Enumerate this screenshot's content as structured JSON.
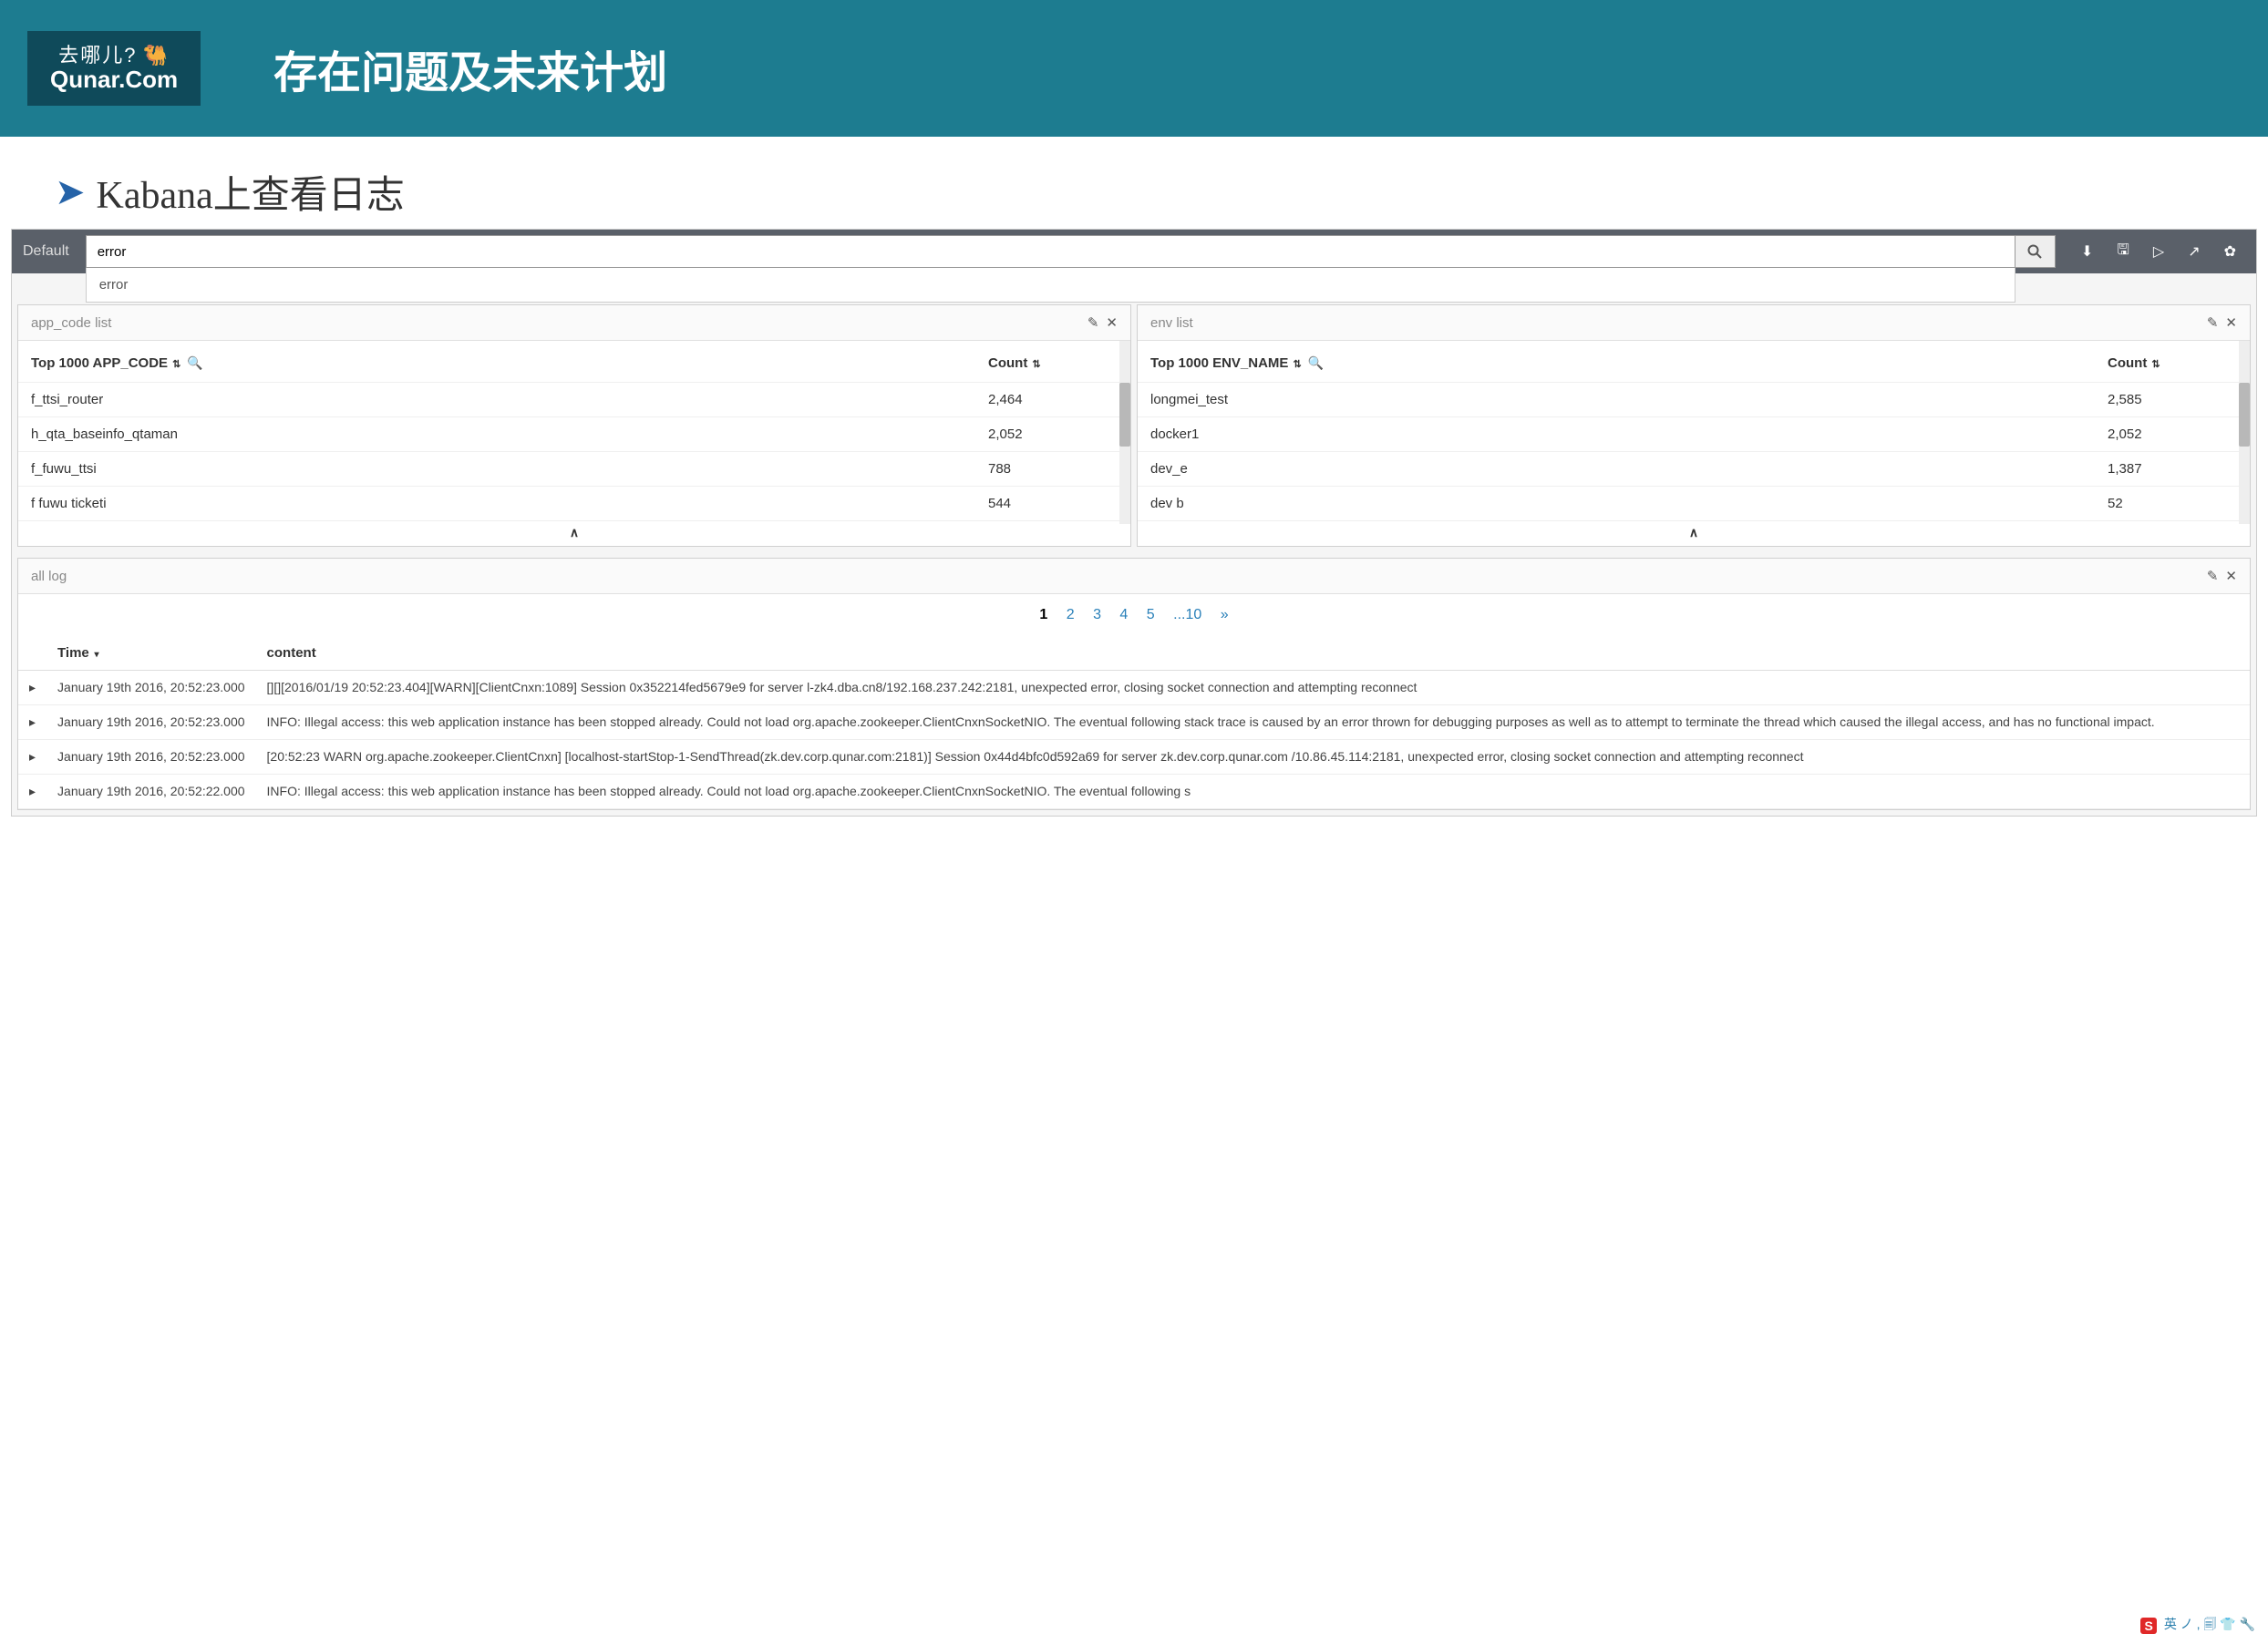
{
  "header": {
    "logo_top": "去哪儿?",
    "logo_bottom": "Qunar.Com",
    "title": "存在问题及未来计划"
  },
  "subtitle": "Kabana上查看日志",
  "search": {
    "default_label": "Default",
    "value": "error",
    "suggestion": "error"
  },
  "panels": {
    "app_code": {
      "title": "app_code list",
      "col1": "Top 1000 APP_CODE",
      "col2": "Count",
      "rows": [
        {
          "name": "f_ttsi_router",
          "count": "2,464"
        },
        {
          "name": "h_qta_baseinfo_qtaman",
          "count": "2,052"
        },
        {
          "name": "f_fuwu_ttsi",
          "count": "788"
        },
        {
          "name": "f fuwu ticketi",
          "count": "544"
        }
      ],
      "footer_arrow": "∧"
    },
    "env": {
      "title": "env list",
      "col1": "Top 1000 ENV_NAME",
      "col2": "Count",
      "rows": [
        {
          "name": "longmei_test",
          "count": "2,585"
        },
        {
          "name": "docker1",
          "count": "2,052"
        },
        {
          "name": "dev_e",
          "count": "1,387"
        },
        {
          "name": "dev b",
          "count": "52"
        }
      ],
      "footer_arrow": "∧"
    }
  },
  "logs": {
    "title": "all log",
    "pager": {
      "current": "1",
      "pages": [
        "2",
        "3",
        "4",
        "5",
        "...10"
      ],
      "next": "»"
    },
    "col_time": "Time",
    "col_content": "content",
    "rows": [
      {
        "time": "January 19th 2016, 20:52:23.000",
        "content": "[][][2016/01/19 20:52:23.404][WARN][ClientCnxn:1089] Session 0x352214fed5679e9 for server l-zk4.dba.cn8/192.168.237.242:2181, unexpected error, closing socket connection and attempting reconnect"
      },
      {
        "time": "January 19th 2016, 20:52:23.000",
        "content": "INFO: Illegal access: this web application instance has been stopped already.  Could not load org.apache.zookeeper.ClientCnxnSocketNIO.  The eventual following stack trace is caused by an error thrown for debugging purposes as well as to attempt to terminate the thread which caused the illegal access, and has no functional impact."
      },
      {
        "time": "January 19th 2016, 20:52:23.000",
        "content": "[20:52:23 WARN org.apache.zookeeper.ClientCnxn] [localhost-startStop-1-SendThread(zk.dev.corp.qunar.com:2181)] Session 0x44d4bfc0d592a69 for server zk.dev.corp.qunar.com /10.86.45.114:2181, unexpected error, closing socket connection and attempting reconnect"
      },
      {
        "time": "January 19th 2016, 20:52:22.000",
        "content": "INFO: Illegal access: this web application instance has been stopped already.  Could not load org.apache.zookeeper.ClientCnxnSocketNIO.  The eventual following s"
      }
    ]
  },
  "tray": {
    "sogou": "S",
    "items": "英 ノ , 🗐 👕 🔧"
  }
}
